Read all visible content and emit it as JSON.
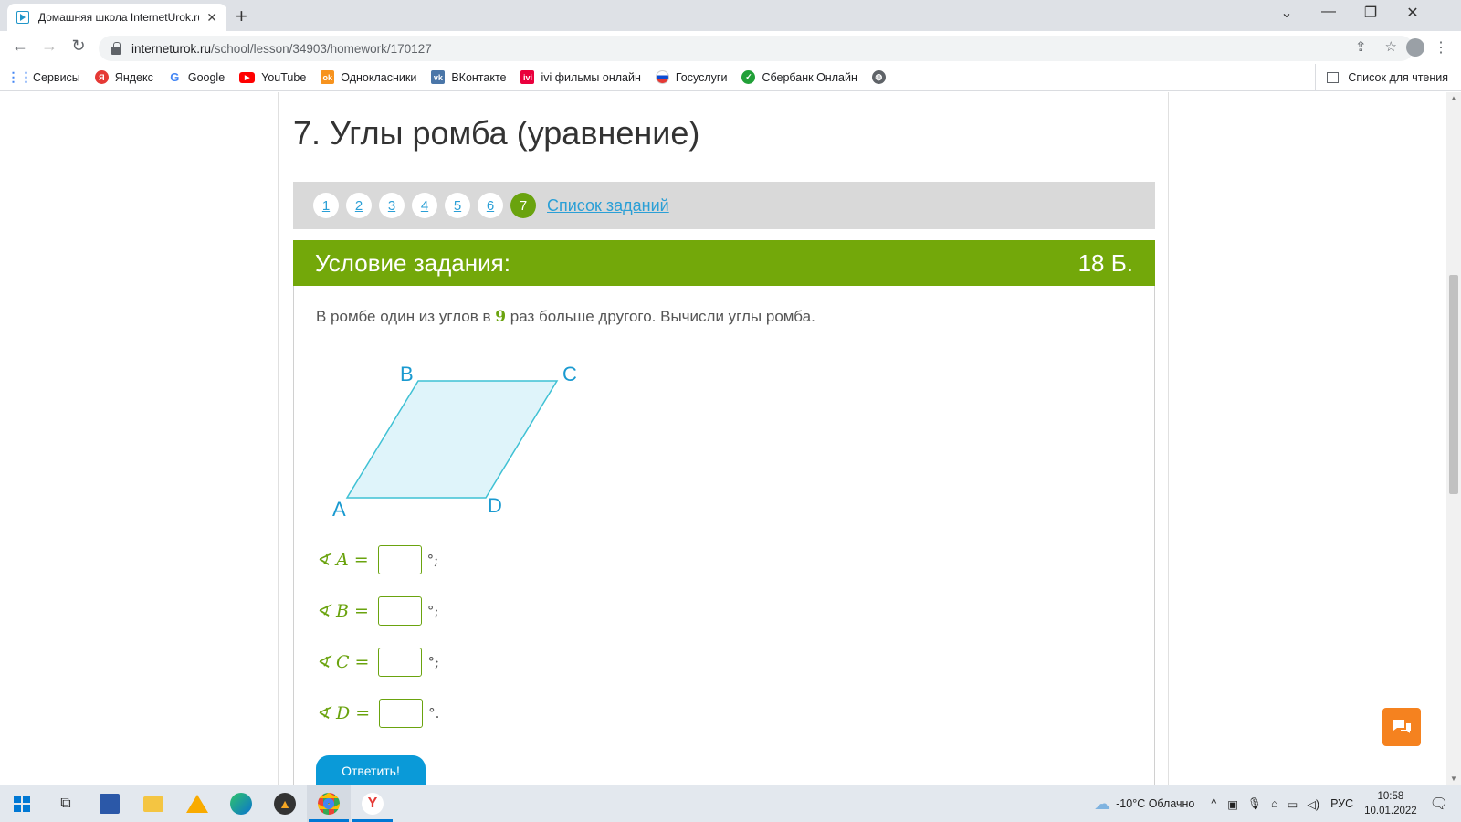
{
  "browser": {
    "tab_title": "Домашняя школа InternetUrok.ru",
    "tab_close": "✕",
    "new_tab": "+",
    "url_host": "interneturok.ru",
    "url_path": "/school/lesson/34903/homework/170127",
    "window_controls": [
      "⌄",
      "—",
      "❐",
      "✕"
    ]
  },
  "bookmarks": [
    {
      "label": "Сервисы",
      "icon": "apps-grid-icon",
      "color": "#4285f4"
    },
    {
      "label": "Яндекс",
      "icon": "yandex-icon",
      "color": "#e53935"
    },
    {
      "label": "Google",
      "icon": "google-icon",
      "color": "#4285f4"
    },
    {
      "label": "YouTube",
      "icon": "youtube-icon",
      "color": "#ff0000"
    },
    {
      "label": "Однокласники",
      "icon": "odnoklassniki-icon",
      "color": "#f7931e"
    },
    {
      "label": "ВКонтакте",
      "icon": "vk-icon",
      "color": "#4a76a8"
    },
    {
      "label": "ivi фильмы онлайн",
      "icon": "ivi-icon",
      "color": "#ea003d"
    },
    {
      "label": "Госуслуги",
      "icon": "gosuslugi-icon",
      "color": "#0d4cd3"
    },
    {
      "label": "Сбербанк Онлайн",
      "icon": "sberbank-icon",
      "color": "#21a038"
    }
  ],
  "reading_list": "Список для чтения",
  "lesson": {
    "title": "7. Углы ромба (уравнение)",
    "pages": [
      "1",
      "2",
      "3",
      "4",
      "5",
      "6",
      "7"
    ],
    "active_page": "7",
    "task_list_link": "Список заданий",
    "task_header": "Условие задания:",
    "points": "18 Б.",
    "condition_before": "В ромбе один из углов в ",
    "condition_number": "9",
    "condition_after": " раз больше другого. Вычисли углы ромба.",
    "figure_labels": {
      "A": "A",
      "B": "B",
      "C": "C",
      "D": "D"
    },
    "answers": [
      {
        "label": "∢ A =",
        "tail": "°;"
      },
      {
        "label": "∢ B =",
        "tail": "°;"
      },
      {
        "label": "∢ C =",
        "tail": "°;"
      },
      {
        "label": "∢ D =",
        "tail": "°."
      }
    ],
    "submit_label": "Ответить!"
  },
  "colors": {
    "accent_green": "#73a80a",
    "link_blue": "#2a9fd6",
    "submit_blue": "#0a9ad8",
    "figure_stroke": "#3fc1d4",
    "figure_fill": "#dff4fa",
    "chat_orange": "#f5821f"
  },
  "taskbar": {
    "weather": "-10°C  Облачно",
    "language": "РУС",
    "time": "10:58",
    "date": "10.01.2022"
  }
}
